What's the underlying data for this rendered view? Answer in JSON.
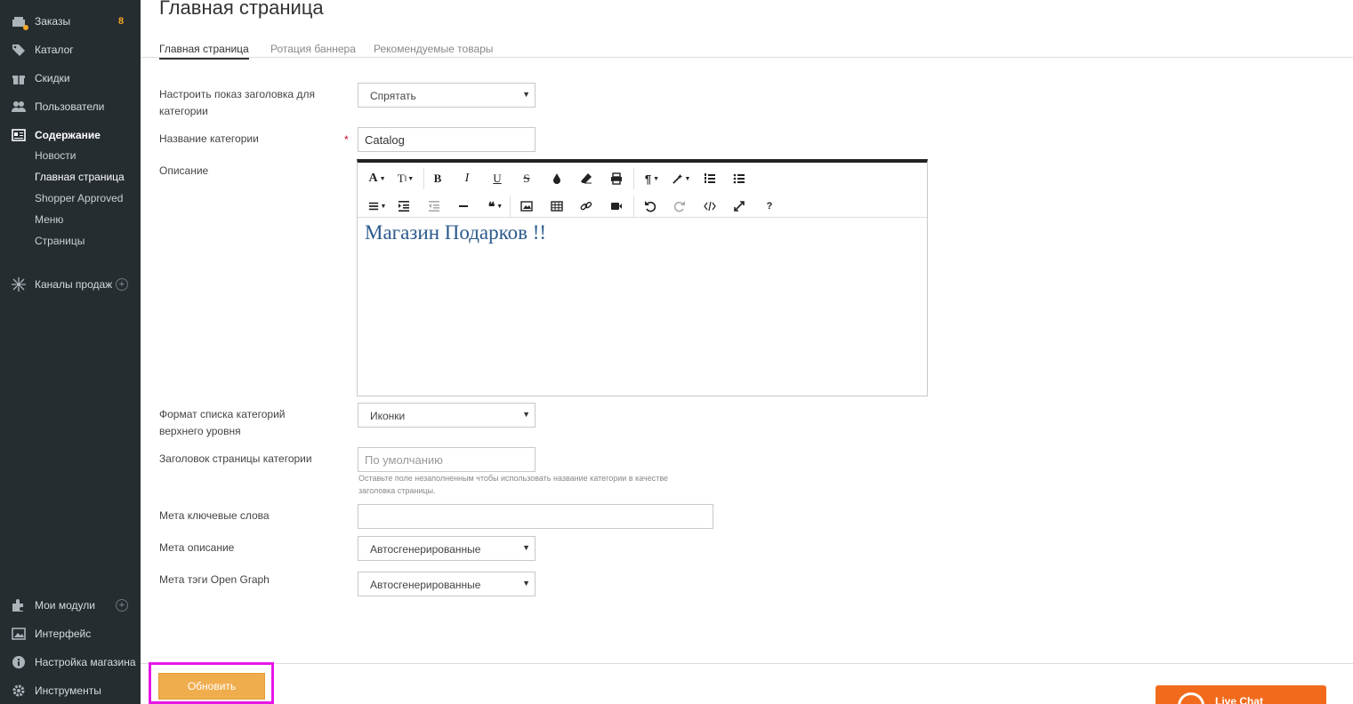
{
  "sidebar": {
    "orders": {
      "label": "Заказы",
      "badge": "8"
    },
    "catalog": {
      "label": "Каталог"
    },
    "discounts": {
      "label": "Скидки"
    },
    "users": {
      "label": "Пользователи"
    },
    "content": {
      "label": "Содержание"
    },
    "content_sub": [
      "Новости",
      "Главная страница",
      "Shopper Approved",
      "Меню",
      "Страницы"
    ],
    "sales_channels": {
      "label": "Каналы продаж"
    },
    "modules": {
      "label": "Мои модули"
    },
    "interface": {
      "label": "Интерфейс"
    },
    "store_settings": {
      "label": "Настройка магазина"
    },
    "tools": {
      "label": "Инструменты"
    },
    "accent_color": "#f5a623"
  },
  "header": {
    "title": "Главная страница",
    "tabs": [
      "Главная страница",
      "Ротация баннера",
      "Рекомендуемые товары"
    ]
  },
  "form": {
    "show_header": {
      "label": "Настроить показ заголовка для категории",
      "value": "Спрятать"
    },
    "category_name": {
      "label": "Название категории",
      "required": "*",
      "value": "Catalog"
    },
    "description": {
      "label": "Описание",
      "content": "Магазин Подарков !!"
    },
    "list_format": {
      "label": "Формат списка категорий верхнего уровня",
      "value": "Иконки"
    },
    "page_title": {
      "label": "Заголовок страницы категории",
      "placeholder": "По умолчанию",
      "hint": "Оставьте поле незаполненным чтобы использовать название категории в качестве заголовка страницы."
    },
    "meta_keywords": {
      "label": "Мета ключевые слова",
      "value": ""
    },
    "meta_description": {
      "label": "Мета описание",
      "value": "Автосгенерированные"
    },
    "meta_og": {
      "label": "Мета тэги Open Graph",
      "value": "Автосгенерированные"
    }
  },
  "toolbar": {
    "row1": [
      "font-icon",
      "text-size-icon",
      "bold-icon",
      "italic-icon",
      "underline-icon",
      "strikethrough-icon",
      "color-icon",
      "eraser-icon",
      "print-icon",
      "paragraph-icon",
      "magic-icon",
      "ordered-list-icon",
      "unordered-list-icon"
    ],
    "row2": [
      "align-icon",
      "indent-icon",
      "outdent-icon",
      "hr-icon",
      "quote-icon",
      "image-icon",
      "table-icon",
      "link-icon",
      "video-icon",
      "undo-icon",
      "redo-icon",
      "code-icon",
      "fullscreen-icon",
      "help-icon"
    ]
  },
  "actions": {
    "update": "Обновить",
    "update_color": "#f0ad4e"
  },
  "livechat": {
    "label": "Live Chat",
    "color": "#f26b1d"
  }
}
